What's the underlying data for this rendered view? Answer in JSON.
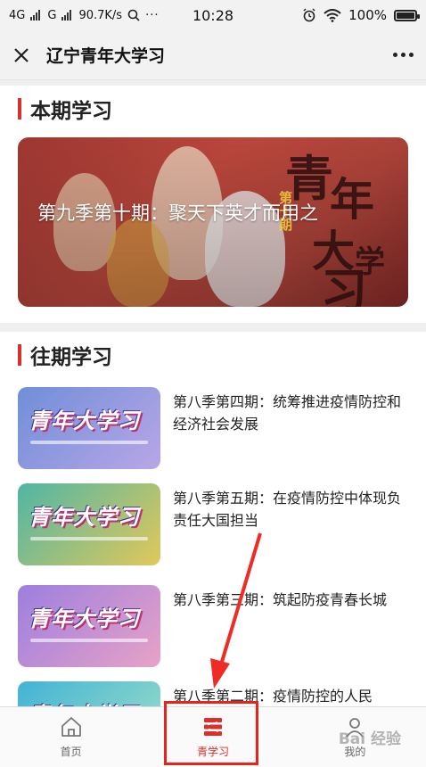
{
  "status_bar": {
    "network1": "4G",
    "network2": "G",
    "speed": "90.7K/s",
    "time": "10:28",
    "battery": "100%"
  },
  "navbar": {
    "title": "辽宁青年大学习"
  },
  "current": {
    "section_title": "本期学习",
    "banner_title": "第九季第十期：聚天下英才而用之",
    "banner_chars": [
      "青",
      "年",
      "大",
      "学",
      "习"
    ],
    "banner_sub": "第十期"
  },
  "past": {
    "section_title": "往期学习",
    "thumb_text": "青年大学习",
    "items": [
      {
        "title": "第八季第四期：统筹推进疫情防控和经济社会发展",
        "color_a": "#6f8fd8",
        "color_b": "#b9a6e6"
      },
      {
        "title": "第八季第五期：在疫情防控中体现负责任大国担当",
        "color_a": "#4fb6a5",
        "color_b": "#e2c85a"
      },
      {
        "title": "第八季第三期：筑起防疫青春长城",
        "color_a": "#9c7fe0",
        "color_b": "#e8a2c6"
      },
      {
        "title": "第八季第二期：疫情防控的人民",
        "color_a": "#43b3d6",
        "color_b": "#9ee0c6"
      }
    ]
  },
  "tabbar": {
    "tab_home": "首页",
    "tab_study": "青学习",
    "tab_mine": "我的"
  },
  "watermark": "Bai 经验",
  "colors": {
    "accent": "#d9302b",
    "highlight": "#e8231c"
  }
}
